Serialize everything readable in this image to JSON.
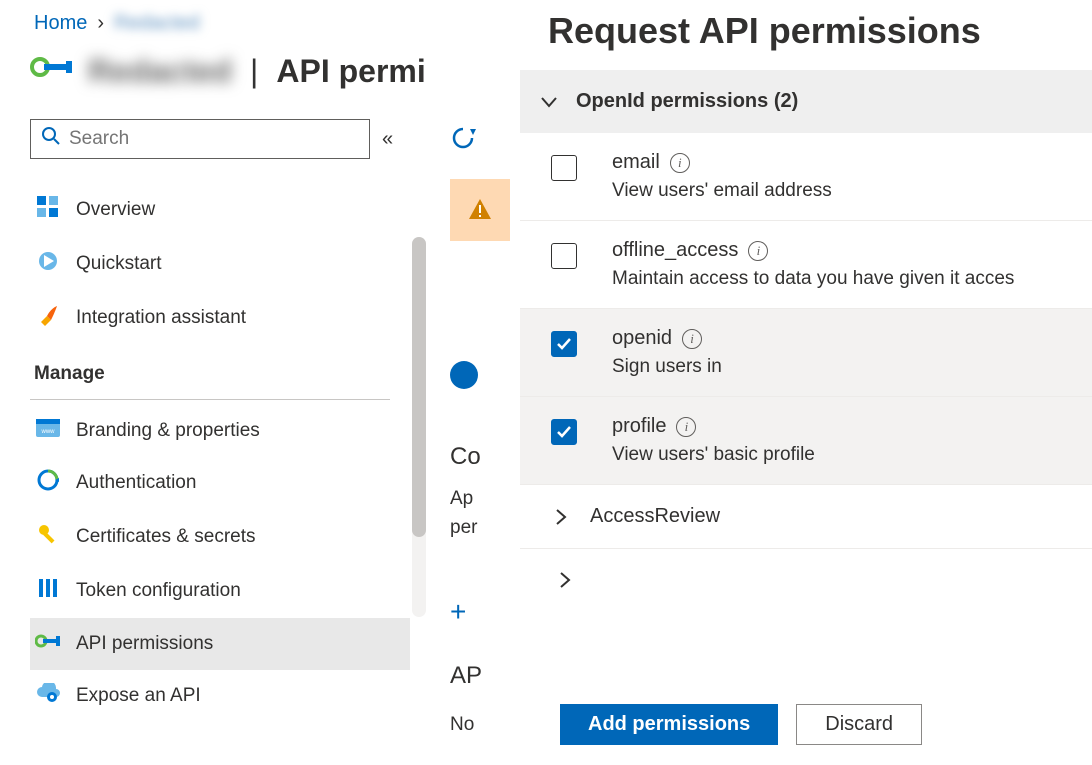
{
  "breadcrumb": {
    "home": "Home",
    "app": "Redacted"
  },
  "page": {
    "app_name": "Redacted",
    "title_suffix": "API permi"
  },
  "search": {
    "placeholder": "Search"
  },
  "nav": {
    "overview": "Overview",
    "quickstart": "Quickstart",
    "integration": "Integration assistant",
    "manage": "Manage",
    "branding": "Branding & properties",
    "authentication": "Authentication",
    "certificates": "Certificates & secrets",
    "token": "Token configuration",
    "api_permissions": "API permissions",
    "expose": "Expose an API"
  },
  "main": {
    "co_label": "Co",
    "desc1": "Ap",
    "desc2": "per",
    "ap_label": "AP",
    "no_label": "No"
  },
  "blade": {
    "title": "Request API permissions",
    "group_label": "OpenId permissions (2)",
    "permissions": [
      {
        "key": "email",
        "name": "email",
        "desc": "View users' email address",
        "checked": false
      },
      {
        "key": "offline_access",
        "name": "offline_access",
        "desc": "Maintain access to data you have given it acces",
        "checked": false
      },
      {
        "key": "openid",
        "name": "openid",
        "desc": "Sign users in",
        "checked": true
      },
      {
        "key": "profile",
        "name": "profile",
        "desc": "View users' basic profile",
        "checked": true
      }
    ],
    "access_review": "AccessReview",
    "add_btn": "Add permissions",
    "discard_btn": "Discard"
  }
}
